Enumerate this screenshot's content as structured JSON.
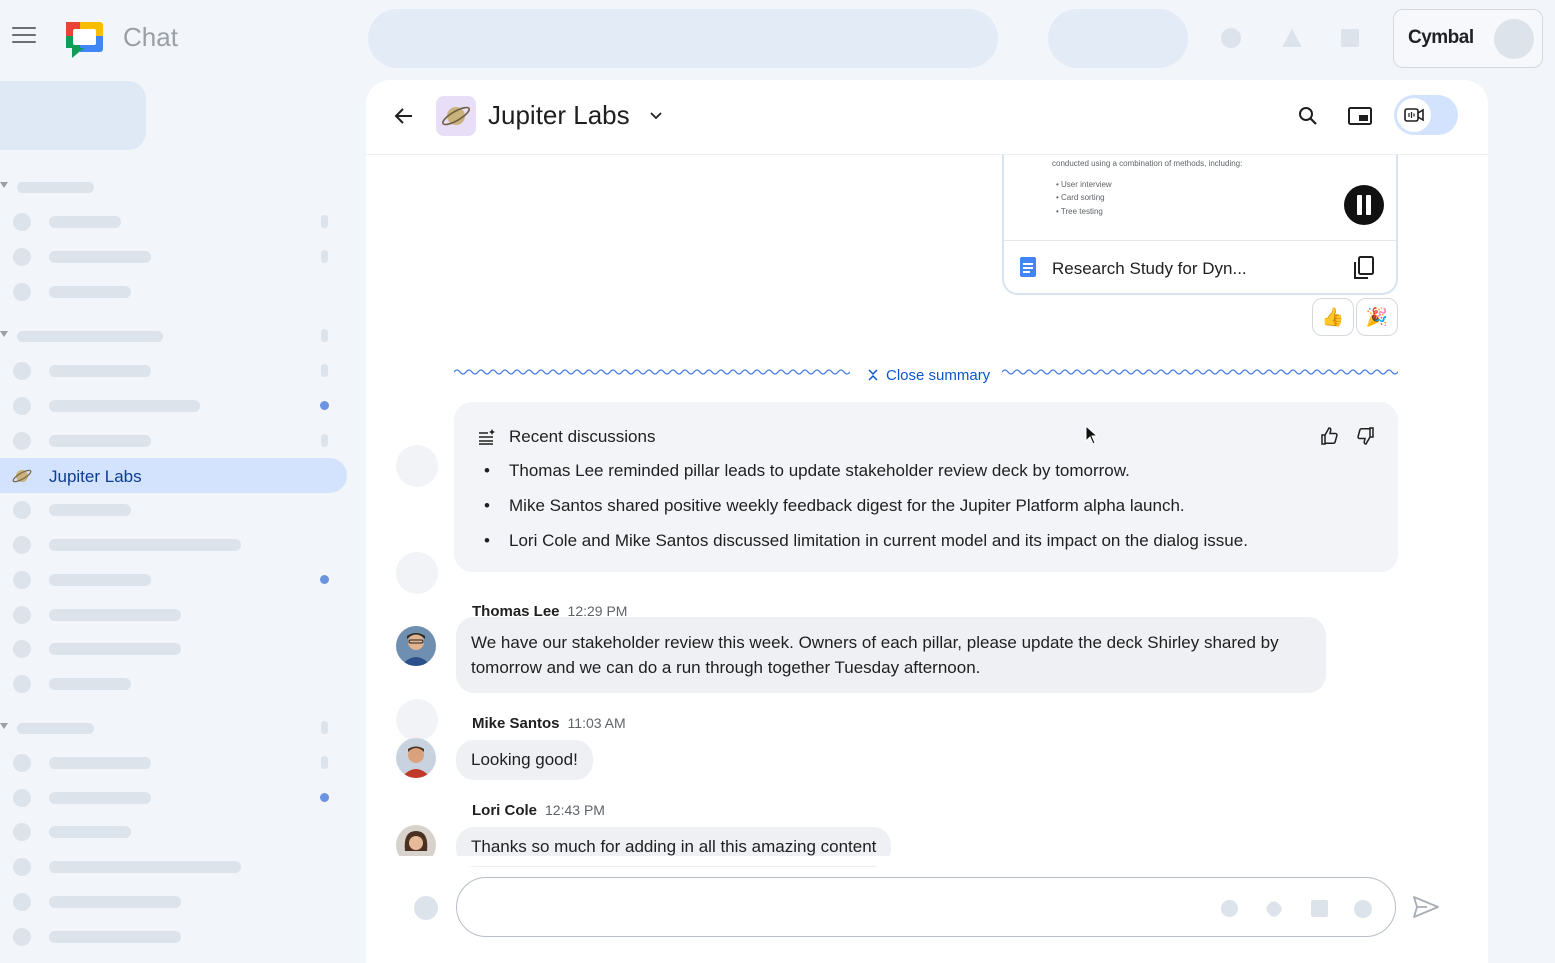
{
  "app": {
    "title": "Chat",
    "brand": "Cymbal"
  },
  "sidebar": {
    "active_item": "Jupiter Labs"
  },
  "room": {
    "title": "Jupiter Labs"
  },
  "doc_card": {
    "intro": "conducted using a combination of methods, including:",
    "bullets": [
      "User interview",
      "Card sorting",
      "Tree testing"
    ],
    "file_name": "Research Study for Dyn...",
    "reactions": [
      "👍",
      "🎉"
    ]
  },
  "summary": {
    "toggle_label": "Close summary",
    "title": "Recent discussions",
    "items": [
      "Thomas Lee reminded pillar leads to update stakeholder review deck by tomorrow.",
      "Mike Santos shared positive weekly feedback digest for the Jupiter Platform alpha launch.",
      "Lori Cole and Mike Santos discussed limitation in current model and its impact on the dialog issue."
    ]
  },
  "messages": [
    {
      "author": "Thomas Lee",
      "time": "12:29 PM",
      "line1": "We have our stakeholder review this week. Owners of each pillar, please update the deck Shirley shared by",
      "line2": "tomorrow and we can do a run through together Tuesday afternoon."
    },
    {
      "author": "Mike Santos",
      "time": "11:03 AM",
      "text": "Looking good!"
    },
    {
      "author": "Lori Cole",
      "time": "12:43 PM",
      "text": "Thanks so much for adding in all this amazing content"
    }
  ],
  "colors": {
    "accent": "#0b57d0",
    "active_nav": "#d3e3fd",
    "bubble": "#eef0f3",
    "summary_bg": "#f2f4f7"
  },
  "icons": [
    "menu-icon",
    "chat-logo-icon",
    "back-arrow-icon",
    "chevron-down-icon",
    "search-icon",
    "picture-in-picture-icon",
    "meet-icon",
    "stop-recording-icon",
    "docs-icon",
    "copy-icon",
    "collapse-icon",
    "summary-icon",
    "thumbs-up-icon",
    "thumbs-down-icon",
    "send-icon"
  ]
}
